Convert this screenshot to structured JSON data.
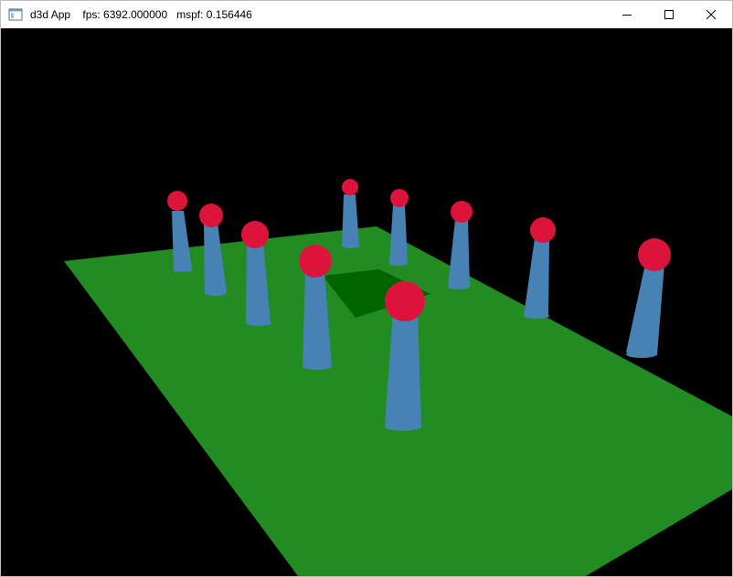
{
  "window": {
    "title": "d3d App    fps: 6392.000000   mspf: 0.156446",
    "icon": "app-window-icon",
    "controls": [
      "minimize-icon",
      "maximize-icon",
      "close-icon"
    ]
  },
  "scene": {
    "background_color": "#000000",
    "ground_color": "#228B22",
    "inner_square_color": "#006400",
    "cylinder_color": "#4682B4",
    "sphere_color": "#DC143C"
  }
}
